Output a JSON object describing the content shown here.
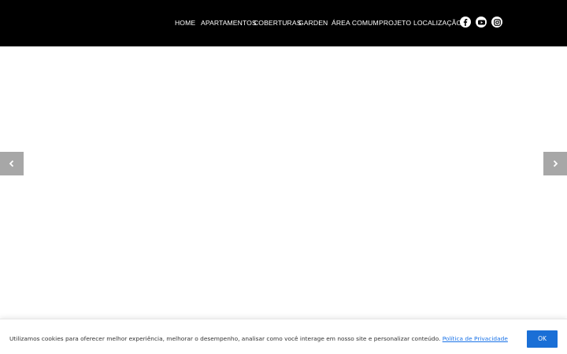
{
  "colors": {
    "header_bg": "#000000",
    "arrow_bg": "#a7a7a7",
    "link": "#1a73e8",
    "button_bg": "#1a6fd6"
  },
  "nav": {
    "items": [
      {
        "label": "HOME"
      },
      {
        "label": "APARTAMENTOS"
      },
      {
        "label": "COBERTURAS"
      },
      {
        "label": "GARDEN"
      },
      {
        "label": "ÁREA COMUM"
      },
      {
        "label": "PROJETO"
      },
      {
        "label": "LOCALIZAÇÃO"
      }
    ]
  },
  "social": [
    {
      "icon": "facebook-icon"
    },
    {
      "icon": "youtube-icon"
    },
    {
      "icon": "instagram-icon"
    }
  ],
  "slider": {
    "prev_icon": "chevron-left-icon",
    "next_icon": "chevron-right-icon"
  },
  "cookie": {
    "text": "Utilizamos cookies para oferecer melhor experiência, melhorar o desempenho, analisar como você interage em nosso site e personalizar conteúdo.",
    "link_label": "Política de Privacidade",
    "button_label": "OK"
  }
}
